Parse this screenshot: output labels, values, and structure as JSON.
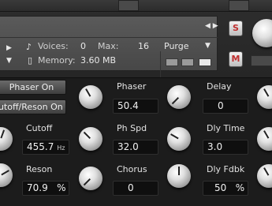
{
  "header": {
    "voices_label": "Voices:",
    "voices_value": "0",
    "max_label": "Max:",
    "max_value": "16",
    "memory_label": "Memory:",
    "memory_value": "3.60 MB",
    "purge_label": "Purge",
    "solo_label": "S",
    "mute_label": "M"
  },
  "toggles": {
    "phaser_on": "Phaser On",
    "cutoff_reson_on": "Cutoff/Reson On"
  },
  "params": {
    "cutoff": {
      "label": "Cutoff",
      "value": "455.7",
      "unit": "Hz"
    },
    "reson": {
      "label": "Reson",
      "value": "70.9",
      "unit": "%"
    },
    "phaser": {
      "label": "Phaser",
      "value": "50.4"
    },
    "ph_spd": {
      "label": "Ph Spd",
      "value": "32.0"
    },
    "chorus": {
      "label": "Chorus",
      "value": "0"
    },
    "delay": {
      "label": "Delay",
      "value": "0"
    },
    "dly_time": {
      "label": "Dly Time",
      "value": "3.0"
    },
    "dly_fdbk": {
      "label": "Dly Fdbk",
      "value": "50",
      "unit": "%"
    }
  }
}
